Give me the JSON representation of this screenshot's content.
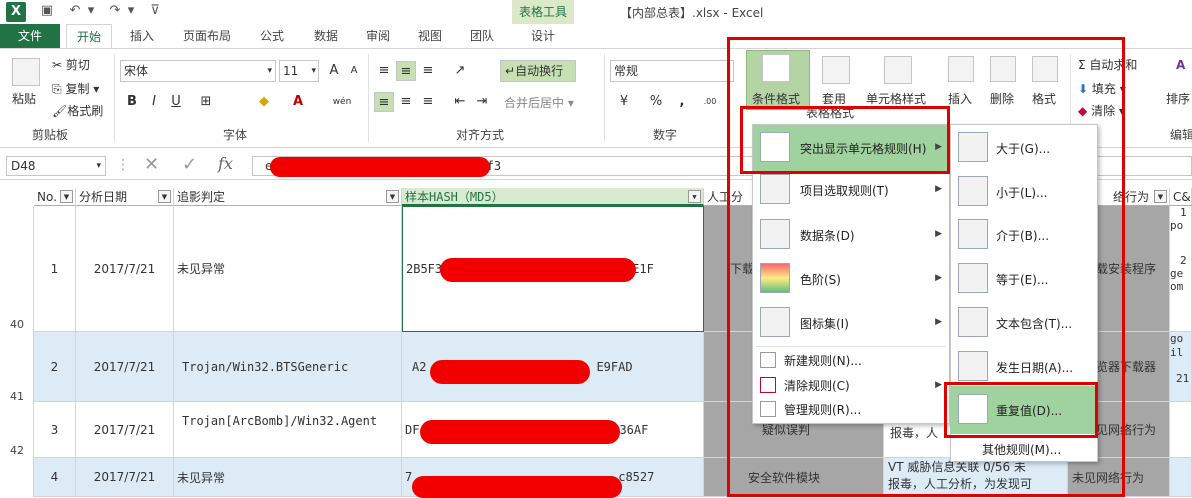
{
  "window": {
    "title": "【内部总表】.xlsx - Excel",
    "context_tab_group": "表格工具"
  },
  "tabs": [
    "文件",
    "开始",
    "插入",
    "页面布局",
    "公式",
    "数据",
    "审阅",
    "视图",
    "团队",
    "设计"
  ],
  "ribbon": {
    "clipboard": {
      "paste": "粘贴",
      "cut": "剪切",
      "copy": "复制",
      "format_painter": "格式刷",
      "group": "剪贴板"
    },
    "font": {
      "name": "宋体",
      "size": "11",
      "bold": "B",
      "italic": "I",
      "underline": "U",
      "group": "字体"
    },
    "alignment": {
      "wrap": "自动换行",
      "merge": "合并后居中",
      "group": "对齐方式"
    },
    "number": {
      "format": "常规",
      "percent": "%",
      "comma": ",",
      "group": "数字"
    },
    "styles": {
      "conditional": "条件格式",
      "table": "套用",
      "table2": "表格格式",
      "cell": "单元格样式"
    },
    "cells": {
      "insert": "插入",
      "delete": "删除",
      "format": "格式"
    },
    "editing": {
      "autosum": "自动求和",
      "fill": "填充",
      "clear": "清除",
      "sort": "排序",
      "group": "编辑"
    }
  },
  "formula_bar": {
    "name_box": "D48",
    "fx": "fx",
    "content_start": "e",
    "content_end": "3af3"
  },
  "columns": [
    "No.",
    "分析日期",
    "追影判定",
    "样本HASH（MD5）",
    "人工分",
    "络行为",
    "C&C"
  ],
  "rows": [
    {
      "rownum": "40",
      "no": "1",
      "date": "2017/7/21",
      "verdict": "未见异常",
      "hash_start": "2B5F3",
      "hash_end": "E1F",
      "manual": "下载",
      "net": "载安装程序",
      "cc": [
        "1",
        "po",
        "2",
        "ge",
        "om"
      ]
    },
    {
      "rownum": "41",
      "no": "2",
      "date": "2017/7/21",
      "verdict": "Trojan/Win32.BTSGeneric",
      "hash_start": "A2",
      "hash_end": "E9FAD",
      "manual": "",
      "net": "览器下载器",
      "cc": [
        "go",
        "il",
        "21"
      ]
    },
    {
      "rownum": "42",
      "no": "3",
      "date": "2017/7/21",
      "verdict": "Trojan[ArcBomb]/Win32.Agent",
      "hash_start": "DF",
      "hash_end": "36AF",
      "manual": "疑似误判",
      "notes": "报毒，人",
      "net": "见网络行为",
      "cc": []
    },
    {
      "rownum": "",
      "no": "4",
      "date": "2017/7/21",
      "verdict": "未见异常",
      "hash_start": "7",
      "hash_end": "c8527",
      "manual": "安全软件模块",
      "notes1": "VT 威胁信息关联 0/56 未",
      "notes2": "报毒，人工分析，为发现可",
      "net": "未见网络行为",
      "cc": []
    }
  ],
  "menu1": {
    "items": [
      {
        "label": "突出显示单元格规则(H)",
        "icon": "highlight-rules-icon"
      },
      {
        "label": "项目选取规则(T)",
        "icon": "top-bottom-icon"
      },
      {
        "label": "数据条(D)",
        "icon": "data-bars-icon"
      },
      {
        "label": "色阶(S)",
        "icon": "color-scales-icon"
      },
      {
        "label": "图标集(I)",
        "icon": "icon-sets-icon"
      }
    ],
    "small": [
      {
        "label": "新建规则(N)..."
      },
      {
        "label": "清除规则(C)"
      },
      {
        "label": "管理规则(R)..."
      }
    ]
  },
  "menu2": {
    "items": [
      {
        "label": "大于(G)..."
      },
      {
        "label": "小于(L)..."
      },
      {
        "label": "介于(B)..."
      },
      {
        "label": "等于(E)..."
      },
      {
        "label": "文本包含(T)..."
      },
      {
        "label": "发生日期(A)..."
      },
      {
        "label": "重复值(D)..."
      }
    ],
    "more": "其他规则(M)..."
  },
  "colors": {
    "excel_green": "#217346",
    "highlight": "#b5d4a5",
    "selected_item": "#9fd29f",
    "annotation_red": "#e00000",
    "row_alt": "#ddebf7",
    "gray_col": "#a6a6a6"
  }
}
